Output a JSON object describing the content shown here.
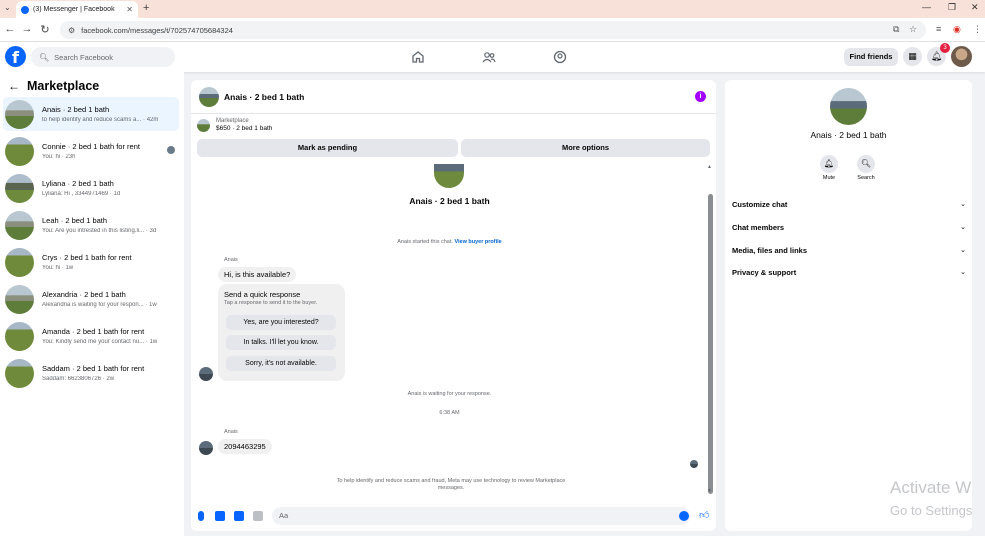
{
  "browser": {
    "tab_title": "(3) Messenger | Facebook",
    "url": "facebook.com/messages/t/702574705684324"
  },
  "fb": {
    "search_placeholder": "Search Facebook",
    "find_friends": "Find friends",
    "notification_count": "3"
  },
  "marketplace": {
    "title": "Marketplace",
    "conversations": [
      {
        "name": "Anais · 2 bed 1 bath",
        "preview": "to help identify and reduce scams a... · 42m",
        "active": true
      },
      {
        "name": "Connie · 2 bed 1 bath for rent",
        "preview": "You: hi · 23h"
      },
      {
        "name": "Lyliana · 2 bed 1 bath",
        "preview": "Lyliana: Hi , 3344971469 · 1d"
      },
      {
        "name": "Leah · 2 bed 1 bath",
        "preview": "You: Are you intrested in this listing.li... · 3d"
      },
      {
        "name": "Crys · 2 bed 1 bath for rent",
        "preview": "You: hi · 1w"
      },
      {
        "name": "Alexandria · 2 bed 1 bath",
        "preview": "Alexandria is waiting for your respon... · 1w"
      },
      {
        "name": "Amanda · 2 bed 1 bath for rent",
        "preview": "You: Kindly send me your contact nu... · 1w"
      },
      {
        "name": "Saddam · 2 bed 1 bath for rent",
        "preview": "Saddam: 6623806726 · 2w"
      }
    ]
  },
  "chat": {
    "header_name": "Anais · 2 bed 1 bath",
    "listing_source": "Marketplace",
    "listing_detail": "$650 · 2 bed 1 bath",
    "mark_pending": "Mark as pending",
    "more_options": "More options",
    "top_name": "Anais · 2 bed 1 bath",
    "started_text": "Anais started this chat.",
    "view_profile": "View buyer profile",
    "sender": "Anais",
    "msg1": "Hi, is this available?",
    "quick_title": "Send a quick response",
    "quick_sub": "Tap a response to send it to the buyer.",
    "quick_options": [
      "Yes, are you interested?",
      "In talks. I'll let you know.",
      "Sorry, it's not available."
    ],
    "waiting_text": "Anais is waiting for your response.",
    "time": "6:38 AM",
    "sender2": "Anais",
    "msg2": "2094463295",
    "disclaimer": "To help identify and reduce scams and fraud, Meta may use technology to review Marketplace messages.",
    "composer_placeholder": "Aa"
  },
  "details": {
    "name": "Anais · 2 bed 1 bath",
    "mute": "Mute",
    "search": "Search",
    "sections": [
      "Customize chat",
      "Chat members",
      "Media, files and links",
      "Privacy & support"
    ]
  },
  "watermark": {
    "line1": "Activate W",
    "line2": "Go to Settings"
  }
}
